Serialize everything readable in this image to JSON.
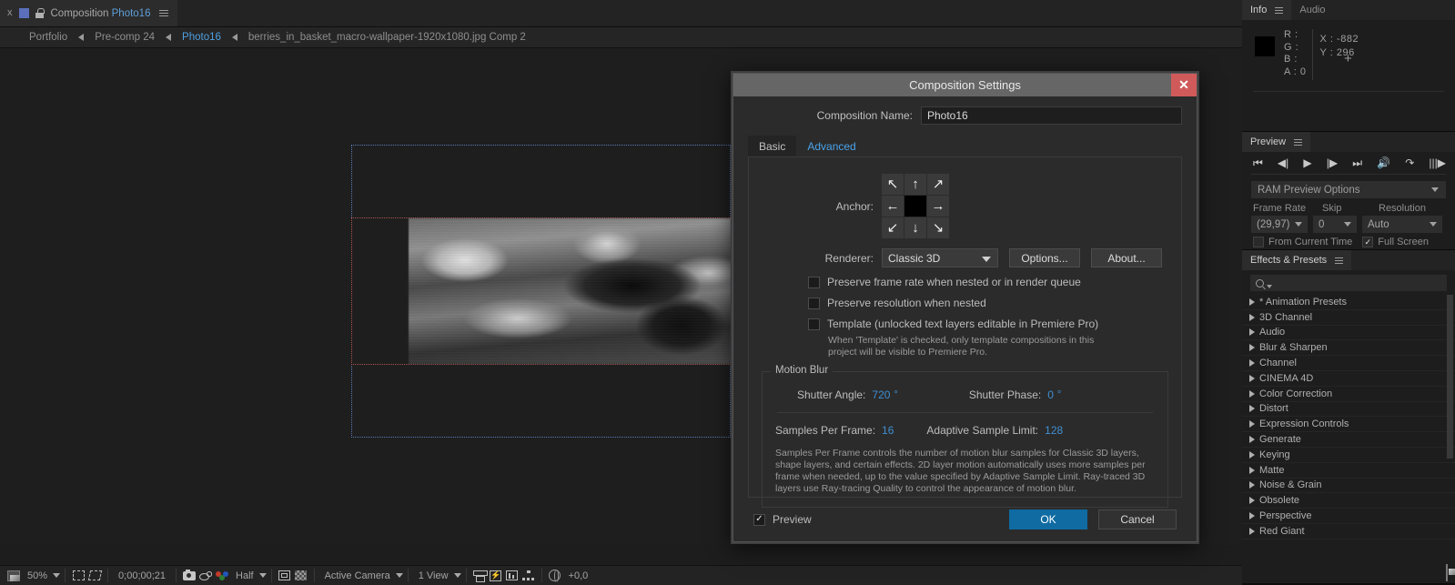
{
  "comp_panel": {
    "tab_label_prefix": "Composition",
    "tab_label_name": "Photo16",
    "close_icon": "x",
    "menu_icon": "hamburger-icon",
    "lock_icon": "lock-icon"
  },
  "breadcrumb": {
    "items": [
      {
        "label": "Portfolio",
        "active": false
      },
      {
        "label": "Pre-comp 24",
        "active": false
      },
      {
        "label": "Photo16",
        "active": true
      },
      {
        "label": "berries_in_basket_macro-wallpaper-1920x1080.jpg Comp 2",
        "active": false
      }
    ]
  },
  "viewer_toolbar": {
    "zoom": "50%",
    "timecode": "0;00;00;21",
    "resolution": "Half",
    "camera": "Active Camera",
    "views": "1 View",
    "offset": "+0,0",
    "icons": [
      "toggle-transparency-grid-icon",
      "region-of-interest-icon",
      "mask-shape-icon",
      "snapshot-icon",
      "show-snapshot-icon",
      "channel-rgb-icon",
      "toggle-mask-icon",
      "transparency-grid-icon",
      "timeline-icon",
      "fast-preview-icon",
      "timeline-graph-icon",
      "comp-flowchart-icon",
      "reset-exposure-icon"
    ]
  },
  "dialog": {
    "title": "Composition Settings",
    "close_label": "✕",
    "comp_name_label": "Composition Name:",
    "comp_name_value": "Photo16",
    "tabs": [
      {
        "label": "Basic",
        "active": false
      },
      {
        "label": "Advanced",
        "active": true
      }
    ],
    "anchor": {
      "label": "Anchor:",
      "cells": [
        "↖",
        "↑",
        "↗",
        "←",
        "",
        "→",
        "↙",
        "↓",
        "↘"
      ],
      "selected_index": 4
    },
    "renderer": {
      "label": "Renderer:",
      "value": "Classic 3D",
      "options_button": "Options...",
      "about_button": "About..."
    },
    "checkboxes": [
      {
        "label": "Preserve frame rate when nested or in render queue",
        "checked": false
      },
      {
        "label": "Preserve resolution when nested",
        "checked": false
      },
      {
        "label": "Template (unlocked text layers editable in Premiere Pro)",
        "checked": false
      }
    ],
    "template_note": "When 'Template' is checked, only template compositions in this project will be visible to Premiere Pro.",
    "motion_blur": {
      "legend": "Motion Blur",
      "shutter_angle_label": "Shutter Angle:",
      "shutter_angle_value": "720",
      "shutter_angle_unit": "°",
      "shutter_phase_label": "Shutter Phase:",
      "shutter_phase_value": "0",
      "shutter_phase_unit": "°",
      "samples_per_frame_label": "Samples Per Frame:",
      "samples_per_frame_value": "16",
      "adaptive_sample_limit_label": "Adaptive Sample Limit:",
      "adaptive_sample_limit_value": "128",
      "description": "Samples Per Frame controls the number of motion blur samples for Classic 3D layers, shape layers, and certain effects. 2D layer motion automatically uses more samples per frame when needed, up to the value specified by Adaptive Sample Limit. Ray-traced 3D layers use Ray-tracing Quality to control the appearance of motion blur."
    },
    "footer": {
      "preview_label": "Preview",
      "preview_checked": true,
      "preview_check_glyph": "✓",
      "ok_label": "OK",
      "cancel_label": "Cancel"
    }
  },
  "info_panel": {
    "tabs": [
      {
        "label": "Info",
        "active": true
      },
      {
        "label": "Audio",
        "active": false
      }
    ],
    "channels": [
      {
        "label": "R :",
        "value": ""
      },
      {
        "label": "G :",
        "value": ""
      },
      {
        "label": "B :",
        "value": ""
      },
      {
        "label": "A :",
        "value": "0"
      }
    ],
    "x_label": "X :",
    "x_value": "-882",
    "y_label": "Y :",
    "y_value": "296",
    "crosshair_icon": "crosshair-icon"
  },
  "preview_panel": {
    "tab_label": "Preview",
    "transport": [
      "first-frame-icon",
      "prev-frame-icon",
      "play-icon",
      "next-frame-icon",
      "last-frame-icon",
      "audio-icon",
      "loop-icon",
      "ram-preview-icon"
    ],
    "ram_preview_options": "RAM Preview Options",
    "frame_rate_label": "Frame Rate",
    "skip_label": "Skip",
    "resolution_label": "Resolution",
    "frame_rate_value": "(29,97)",
    "skip_value": "0",
    "resolution_value": "Auto",
    "from_current_time_label": "From Current Time",
    "from_current_time_checked": false,
    "full_screen_label": "Full Screen",
    "full_screen_checked": true,
    "check_glyph": "✓"
  },
  "effects_panel": {
    "tab_label": "Effects & Presets",
    "search_placeholder": "",
    "categories": [
      "* Animation Presets",
      "3D Channel",
      "Audio",
      "Blur & Sharpen",
      "Channel",
      "CINEMA 4D",
      "Color Correction",
      "Distort",
      "Expression Controls",
      "Generate",
      "Keying",
      "Matte",
      "Noise & Grain",
      "Obsolete",
      "Perspective",
      "Red Giant"
    ]
  },
  "colors": {
    "accent_blue": "#4aa3ea",
    "ok_button": "#0f6ba2",
    "close_red": "#d05a5a",
    "value_blue": "#3f8fd2",
    "panel_bg": "#1d1d1d",
    "dialog_bg": "#2b2b2b"
  }
}
